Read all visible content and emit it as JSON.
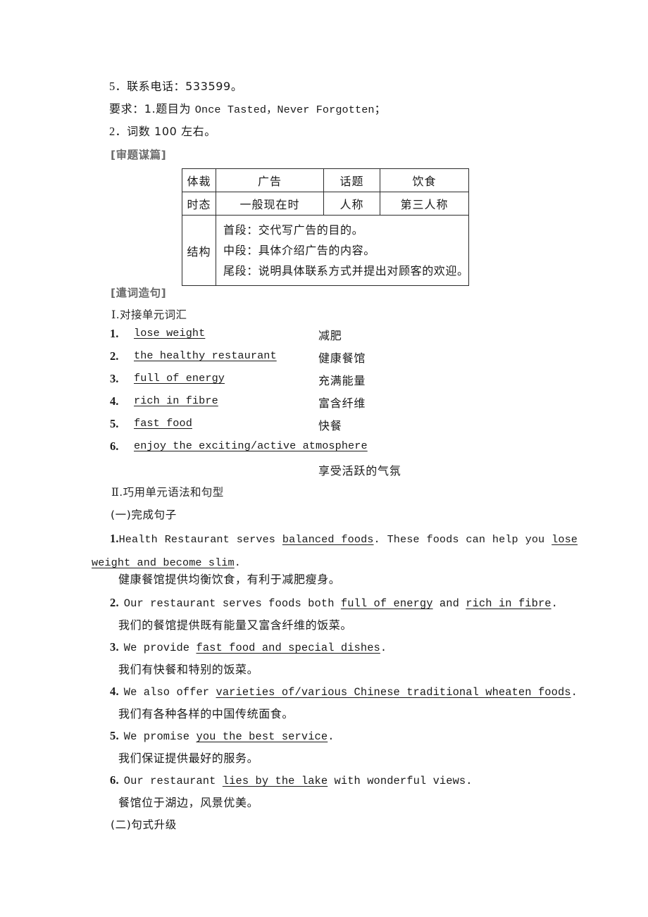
{
  "intro": {
    "item5": {
      "num": "5．",
      "text": "联系电话：533599。"
    },
    "requirement1": {
      "prefix": "要求：1.题目为 ",
      "en": "Once Tasted，Never Forgotten",
      "suffix": "；"
    },
    "requirement2": {
      "num": "2．",
      "text": "词数 100 左右。"
    }
  },
  "section_headings": {
    "analysis": "[审题谋篇]",
    "wording": "[遣词造句]"
  },
  "analysis_table": {
    "row1": {
      "label": "体裁",
      "value": "广告",
      "label2": "话题",
      "value2": "饮食"
    },
    "row2": {
      "label": "时态",
      "value": "一般现在时",
      "label2": "人称",
      "value2": "第三人称"
    },
    "row3": {
      "label": "结构",
      "lines": [
        "首段：交代写广告的目的。",
        "中段：具体介绍广告的内容。",
        "尾段：说明具体联系方式并提出对顾客的欢迎。"
      ]
    }
  },
  "part1": {
    "heading_numeral": "Ⅰ",
    "heading_text": ".对接单元词汇",
    "items": [
      {
        "num": "1.",
        "en": "lose weight",
        "cn": "减肥"
      },
      {
        "num": "2.",
        "en": "the healthy restaurant",
        "cn": "健康餐馆"
      },
      {
        "num": "3.",
        "en": "full of energy",
        "cn": "充满能量"
      },
      {
        "num": "4.",
        "en": "rich in fibre",
        "cn": "富含纤维"
      },
      {
        "num": "5.",
        "en": "fast food",
        "cn": "快餐"
      },
      {
        "num": "6.",
        "en": "enjoy the exciting/active atmosphere",
        "cn": "享受活跃的气氛"
      }
    ]
  },
  "part2": {
    "heading_numeral": "Ⅱ",
    "heading_text": ".巧用单元语法和句型",
    "subsection_a": "(一)完成句子",
    "subsection_b": "(二)句式升级",
    "sentences": [
      {
        "num": "1.",
        "segments": [
          {
            "text": "Health Restaurant serves ",
            "underline": false
          },
          {
            "text": "balanced foods",
            "underline": true
          },
          {
            "text": ". These foods can help you ",
            "underline": false
          },
          {
            "text": "lose weight and become slim",
            "underline": true
          },
          {
            "text": ".",
            "underline": false
          }
        ],
        "cn": "健康餐馆提供均衡饮食，有利于减肥瘦身。"
      },
      {
        "num": "2.",
        "segments": [
          {
            "text": "Our restaurant serves foods both ",
            "underline": false
          },
          {
            "text": "full of energy",
            "underline": true
          },
          {
            "text": " and ",
            "underline": false
          },
          {
            "text": "rich in fibre",
            "underline": true
          },
          {
            "text": ".",
            "underline": false
          }
        ],
        "cn": "我们的餐馆提供既有能量又富含纤维的饭菜。"
      },
      {
        "num": "3.",
        "segments": [
          {
            "text": "We provide ",
            "underline": false
          },
          {
            "text": "fast food and special dishes",
            "underline": true
          },
          {
            "text": ".",
            "underline": false
          }
        ],
        "cn": "我们有快餐和特别的饭菜。"
      },
      {
        "num": "4.",
        "segments": [
          {
            "text": "We also offer ",
            "underline": false
          },
          {
            "text": "varieties of/various Chinese traditional wheaten foods",
            "underline": true
          },
          {
            "text": ".",
            "underline": false
          }
        ],
        "cn": "我们有各种各样的中国传统面食。"
      },
      {
        "num": "5.",
        "segments": [
          {
            "text": "We promise ",
            "underline": false
          },
          {
            "text": "you the best service",
            "underline": true
          },
          {
            "text": ".",
            "underline": false
          }
        ],
        "cn": "我们保证提供最好的服务。"
      },
      {
        "num": "6.",
        "segments": [
          {
            "text": "Our restaurant ",
            "underline": false
          },
          {
            "text": "lies by the lake",
            "underline": true
          },
          {
            "text": " with wonderful views.",
            "underline": false
          }
        ],
        "cn": "餐馆位于湖边，风景优美。"
      }
    ]
  }
}
